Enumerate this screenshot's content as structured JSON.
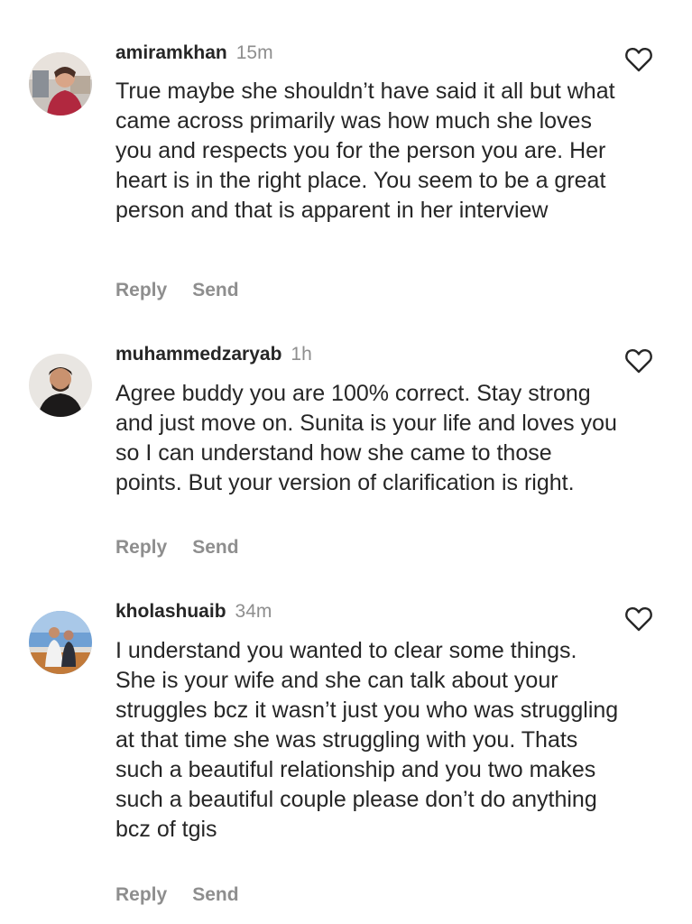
{
  "comments": [
    {
      "username": "amiramkhan",
      "time": "15m",
      "text": "True maybe she shouldn’t have said it all but what came across primarily was how much she loves you and respects you for the person you are. Her heart is in the right place. You seem to be a great person and that is apparent in her interview",
      "reply_label": "Reply",
      "send_label": "Send",
      "like_icon": "heart-outline-icon"
    },
    {
      "username": "muhammedzaryab",
      "time": "1h",
      "text": "Agree buddy you are 100% correct. Stay strong and just move on. Sunita is your life and loves you so I can understand how she came to those points. But your version of clarification is right.",
      "reply_label": "Reply",
      "send_label": "Send",
      "like_icon": "heart-outline-icon"
    },
    {
      "username": "kholashuaib",
      "time": "34m",
      "text": "I understand you wanted to clear some things. She is your wife and she can talk about your struggles bcz it wasn’t just you who was struggling at that time she was struggling with you. Thats such a beautiful relationship and you two makes such a beautiful couple please don’t do anything bcz of tgis",
      "reply_label": "Reply",
      "send_label": "Send",
      "like_icon": "heart-outline-icon"
    }
  ],
  "colors": {
    "primary_text": "#262626",
    "secondary_text": "#8e8e8e",
    "background": "#ffffff"
  }
}
